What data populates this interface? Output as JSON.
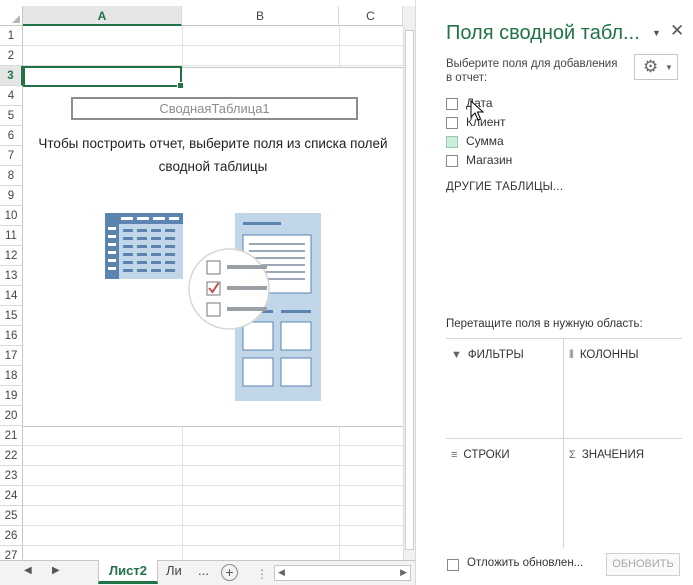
{
  "sheet": {
    "columns": [
      {
        "label": "A",
        "active": true
      },
      {
        "label": "B",
        "active": false
      },
      {
        "label": "C",
        "active": false
      }
    ],
    "rows": [
      "1",
      "2",
      "3",
      "4",
      "5",
      "6",
      "7",
      "8",
      "9",
      "10",
      "11",
      "12",
      "13",
      "14",
      "15",
      "16",
      "17",
      "18",
      "19",
      "20",
      "21",
      "22",
      "23",
      "24",
      "25",
      "26",
      "27"
    ],
    "active_row": "3",
    "pivot_name": "СводнаяТаблица1",
    "pivot_hint": "Чтобы построить отчет, выберите поля из списка полей сводной таблицы"
  },
  "tabs": {
    "active": "Лист2",
    "other": "Ли",
    "ellipsis": "...",
    "add": "+"
  },
  "pane": {
    "title": "Поля сводной табл...",
    "instructions": "Выберите поля для добавления в отчет:",
    "fields": [
      {
        "label": "Дата",
        "checked": false,
        "highlight": false
      },
      {
        "label": "Клиент",
        "checked": false,
        "highlight": false
      },
      {
        "label": "Сумма",
        "checked": false,
        "highlight": true
      },
      {
        "label": "Магазин",
        "checked": false,
        "highlight": false
      }
    ],
    "more_tables": "ДРУГИЕ ТАБЛИЦЫ...",
    "drag_hint": "Перетащите поля в нужную область:",
    "areas": {
      "filters": "ФИЛЬТРЫ",
      "columns": "КОЛОННЫ",
      "rows": "СТРОКИ",
      "values": "ЗНАЧЕНИЯ"
    },
    "defer_label": "Отложить обновлен...",
    "update_button": "ОБНОВИТЬ"
  },
  "colors": {
    "accent": "#217346",
    "illustration_blue": "#5b84b1",
    "illustration_light": "#c2d6ea",
    "check_red": "#c0504d"
  }
}
